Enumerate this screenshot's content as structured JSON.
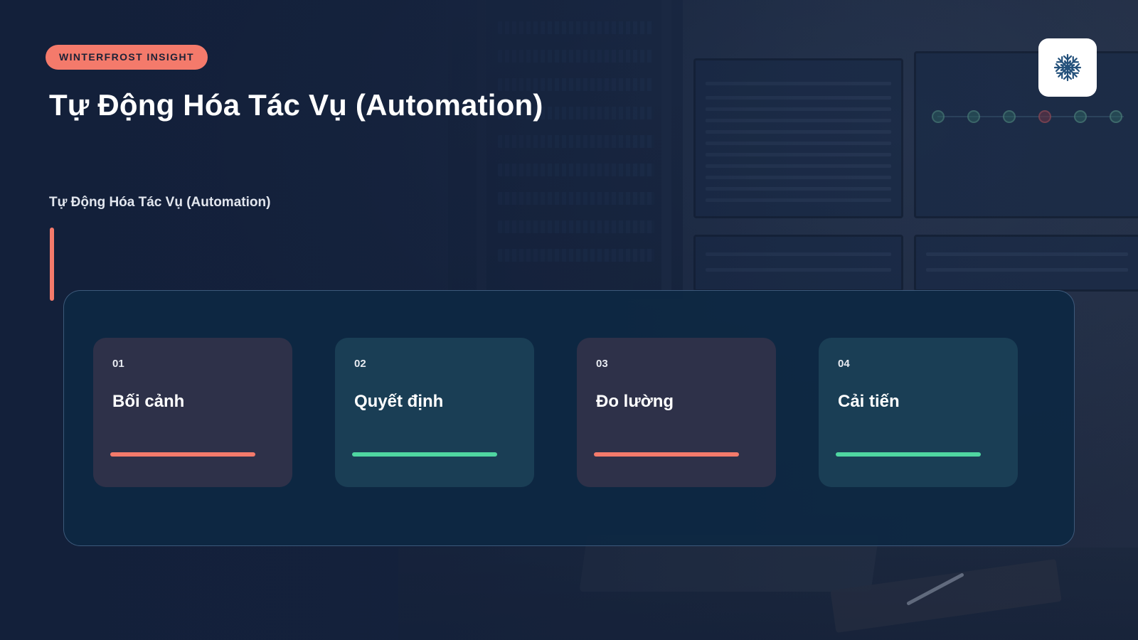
{
  "brand": {
    "label": "WINTERFROST INSIGHT"
  },
  "logo": {
    "icon": "snowflake-icon",
    "color": "#23507a"
  },
  "page": {
    "title": "Tự Động Hóa Tác Vụ (Automation)",
    "subtitle": "Tự Động Hóa Tác Vụ (Automation)"
  },
  "colors": {
    "accent_coral": "#f47a6b",
    "accent_teal": "#4fd6a1",
    "background": "#13203a",
    "panel": "#0d2843"
  },
  "cards": [
    {
      "number": "01",
      "title": "Bối cảnh",
      "accent": "coral"
    },
    {
      "number": "02",
      "title": "Quyết định",
      "accent": "teal"
    },
    {
      "number": "03",
      "title": "Đo lường",
      "accent": "coral"
    },
    {
      "number": "04",
      "title": "Cải tiến",
      "accent": "teal"
    }
  ]
}
